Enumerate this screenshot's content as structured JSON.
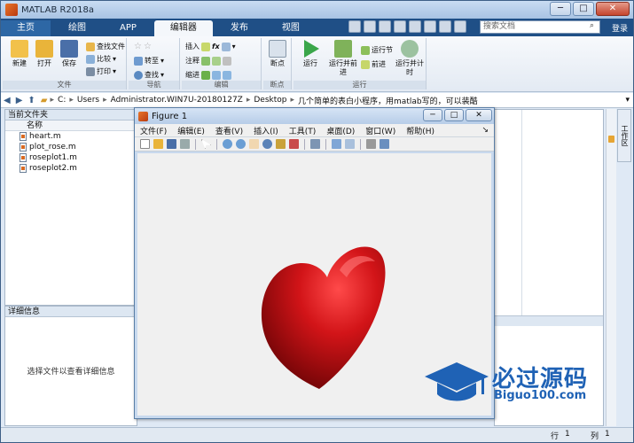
{
  "window": {
    "title": "MATLAB R2018a",
    "minimize": "─",
    "maximize": "□",
    "close": "✕"
  },
  "ribbon_tabs": [
    {
      "label": "主页"
    },
    {
      "label": "绘图"
    },
    {
      "label": "APP"
    },
    {
      "label": "编辑器"
    },
    {
      "label": "发布"
    },
    {
      "label": "视图"
    }
  ],
  "search": {
    "placeholder": "搜索文档",
    "button": "登录"
  },
  "ribbon": {
    "file_group": {
      "label": "文件",
      "new": "新建",
      "open": "打开",
      "save": "保存",
      "find_files": "查找文件",
      "compare": "比较",
      "print": "打印"
    },
    "nav_group": {
      "label": "导航",
      "goto": "转至",
      "find": "查找"
    },
    "edit_group": {
      "label": "编辑",
      "insert": "插入",
      "comment": "注释",
      "indent": "缩进",
      "fx": "fx"
    },
    "breakpoint_group": {
      "label": "断点",
      "breakpoints": "断点"
    },
    "run_group": {
      "label": "运行",
      "run": "运行",
      "run_advance": "运行并前进",
      "run_section": "运行节",
      "advance": "前进",
      "run_time": "运行并计时"
    }
  },
  "address": {
    "crumbs": [
      "C:",
      "Users",
      "Administrator.WIN7U-20180127Z",
      "Desktop",
      "几个简单的表白小程序，用matlab写的，可以装酷"
    ],
    "overflow": "lab写的，可以装酷\\heart..."
  },
  "current_folder": {
    "title": "当前文件夹",
    "column": "名称",
    "files": [
      "heart.m",
      "plot_rose.m",
      "roseplot1.m",
      "roseplot2.m"
    ]
  },
  "details": {
    "title": "详细信息",
    "message": "选择文件以查看详细信息"
  },
  "workspace_tab": "工作区",
  "status": {
    "row_label": "行",
    "row": "1",
    "col_label": "列",
    "col": "1"
  },
  "figure": {
    "title": "Figure 1",
    "menu": [
      "文件(F)",
      "编辑(E)",
      "查看(V)",
      "插入(I)",
      "工具(T)",
      "桌面(D)",
      "窗口(W)",
      "帮助(H)"
    ],
    "dock_arrow": "↘"
  },
  "watermark": {
    "title": "必过源码",
    "subtitle": "Biguo100.com"
  },
  "colors": {
    "heart": "#c8141a",
    "accent": "#1f4f86",
    "watermark": "#1f62b5"
  }
}
